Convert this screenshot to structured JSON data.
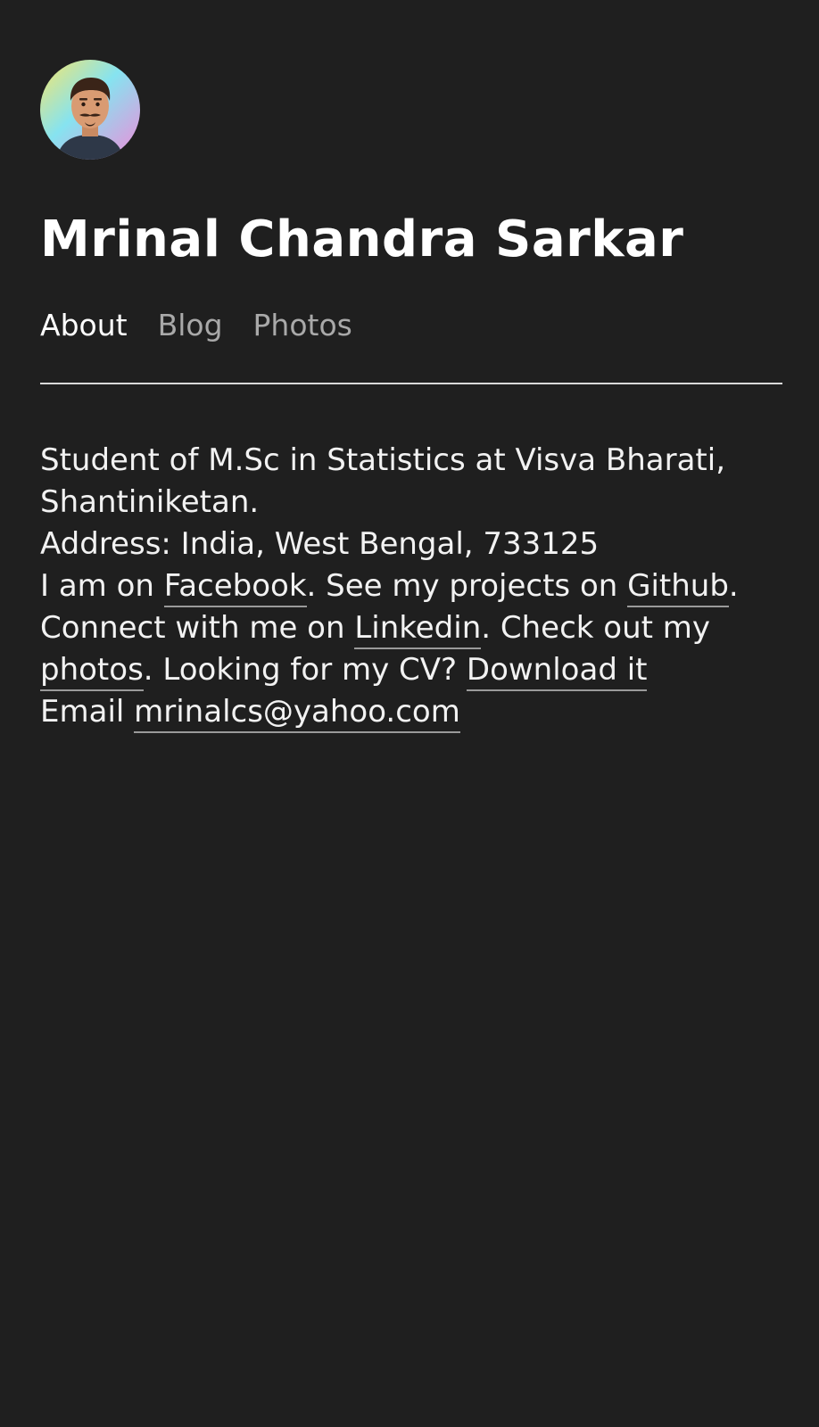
{
  "header": {
    "avatar_icon": "person-avatar-icon",
    "title": "Mrinal Chandra Sarkar"
  },
  "nav": {
    "items": [
      {
        "label": "About",
        "active": true
      },
      {
        "label": "Blog",
        "active": false
      },
      {
        "label": "Photos",
        "active": false
      }
    ]
  },
  "bio": {
    "line1": "Student of M.Sc in Statistics at Visva Bharati,",
    "line2": "Shantiniketan.",
    "address": "Address: India, West Bengal, 733125",
    "facebook_prefix": "I am on ",
    "facebook_link": "Facebook",
    "github_prefix": ". See my projects on ",
    "github_link": "Github",
    "github_suffix": ".",
    "linkedin_prefix": "Connect with me on ",
    "linkedin_link": "Linkedin",
    "photos_prefix": ". Check out my ",
    "photos_link": "photos",
    "cv_prefix": ". Looking for my CV? ",
    "cv_link": "Download it",
    "email_prefix": "Email ",
    "email_link": "mrinalcs@yahoo.com"
  },
  "colors": {
    "background": "#1f1f1f",
    "text": "#f2f2f2",
    "nav_inactive": "#a9a9a9"
  }
}
